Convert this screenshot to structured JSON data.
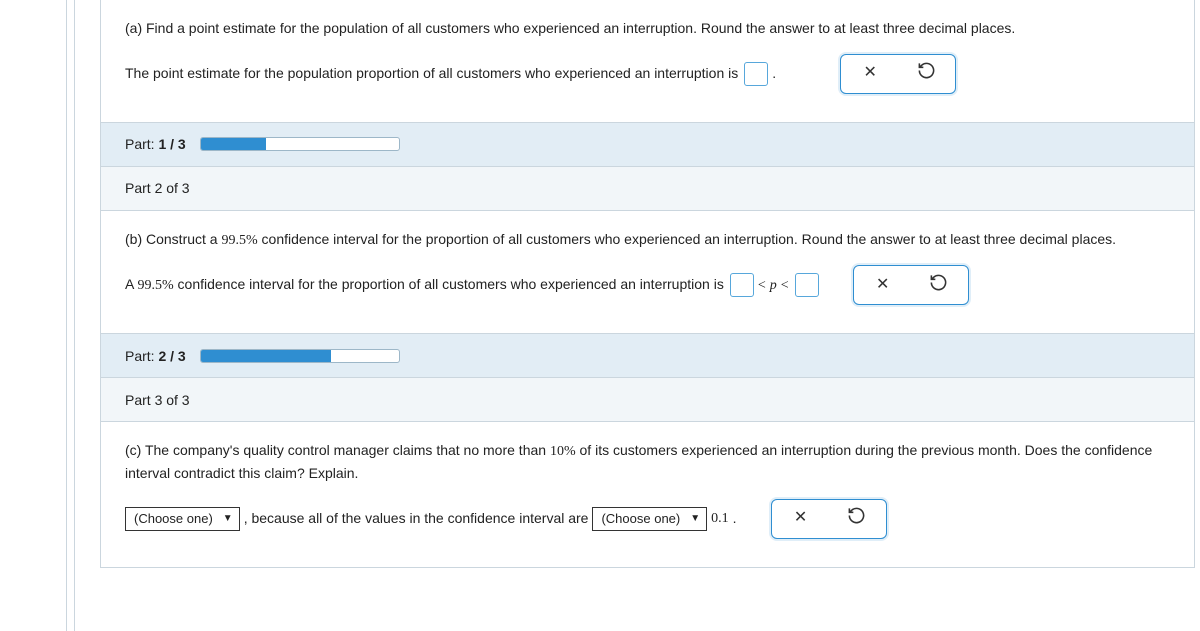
{
  "partA": {
    "prompt": "(a) Find a point estimate for the population of all customers who experienced an interruption. Round the answer to at least three decimal places.",
    "sentence": "The point estimate for the population proportion of all customers who experienced an interruption is",
    "period": "."
  },
  "progress1": {
    "prefix": "Part: ",
    "num": "1 / 3",
    "percent": 33
  },
  "part2Header": "Part 2 of 3",
  "partB": {
    "prompt_pre": "(b) Construct a ",
    "pct1": "99.5%",
    "prompt_post": " confidence interval for the proportion of all customers who experienced an interruption. Round the answer to at least three decimal places.",
    "sentence_pre": "A ",
    "pct2": "99.5%",
    "sentence_post": " confidence interval for the proportion of all customers who experienced an interruption is",
    "lt1": "<",
    "p": "p",
    "lt2": "<"
  },
  "progress2": {
    "prefix": "Part: ",
    "num": "2 / 3",
    "percent": 66
  },
  "part3Header": "Part 3 of 3",
  "partC": {
    "prompt_pre": "(c) The company's quality control manager claims that no more than ",
    "tenpct": "10%",
    "prompt_post": " of its customers experienced an interruption during the previous month. Does the confidence interval contradict this claim? Explain.",
    "choose": "(Choose one)",
    "mid": ", because all of the values in the confidence interval are",
    "val": "0.1",
    "period": "."
  }
}
